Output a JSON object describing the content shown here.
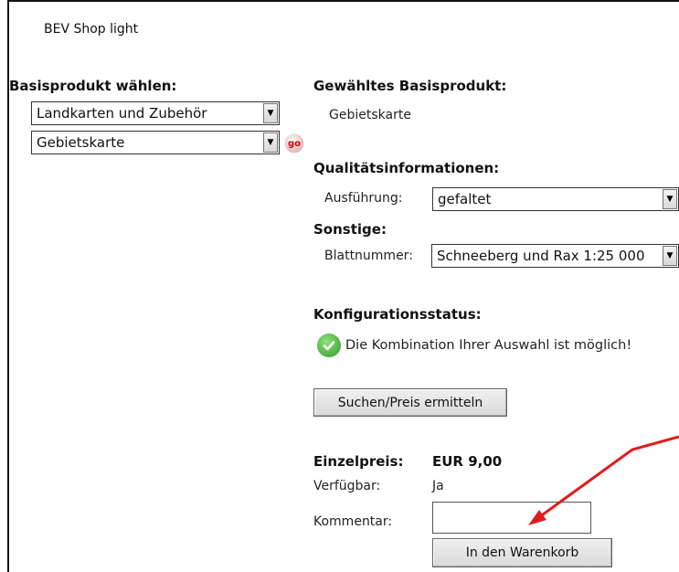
{
  "header": {
    "title": "BEV Shop light"
  },
  "left": {
    "heading": "Basisprodukt wählen:",
    "select1_value": "Landkarten und Zubehör",
    "select2_value": "Gebietskarte",
    "go_label": "go"
  },
  "right": {
    "selected_heading": "Gewähltes Basisprodukt:",
    "selected_value": "Gebietskarte",
    "quality_heading": "Qualitätsinformationen:",
    "ausfuehrung_label": "Ausführung:",
    "ausfuehrung_value": "gefaltet",
    "other_heading": "Sonstige:",
    "blatt_label": "Blattnummer:",
    "blatt_value": "Schneeberg und Rax 1:25 000",
    "status_heading": "Konfigurationsstatus:",
    "status_text": "Die Kombination Ihrer Auswahl ist möglich!",
    "search_button": "Suchen/Preis ermitteln",
    "price_label": "Einzelpreis:",
    "price_value": "EUR 9,00",
    "availability_label": "Verfügbar:",
    "availability_value": "Ja",
    "comment_label": "Kommentar:",
    "comment_value": "",
    "cart_button": "In den Warenkorb"
  },
  "colors": {
    "annotation_arrow": "#e01b1b",
    "check_green": "#2f9a2a"
  }
}
